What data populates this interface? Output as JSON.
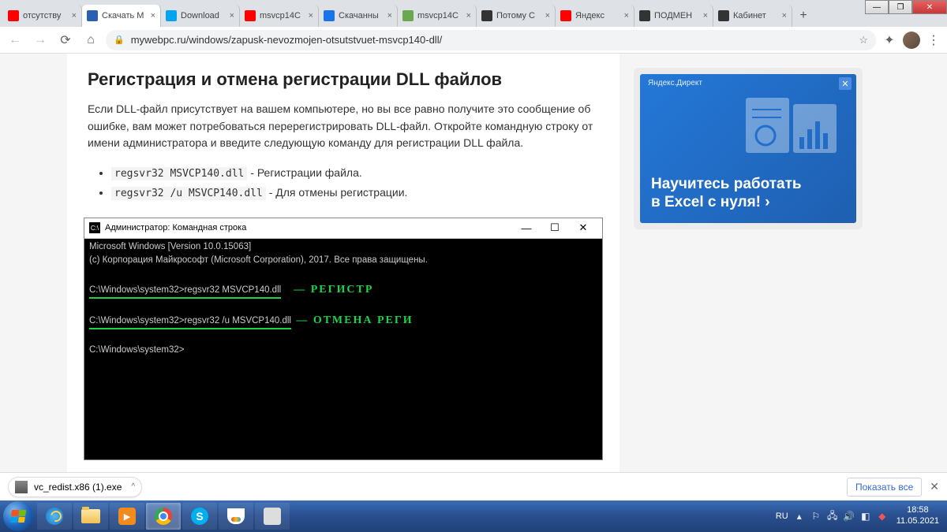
{
  "window_controls": {
    "min": "—",
    "max": "❐",
    "close": "✕"
  },
  "tabs": [
    {
      "title": "отсутству",
      "icon": "#ff0000"
    },
    {
      "title": "Скачать M",
      "icon": "#2b5fb0",
      "active": true
    },
    {
      "title": "Download",
      "icon": "#00a4ef"
    },
    {
      "title": "msvcp14C",
      "icon": "#ff0000"
    },
    {
      "title": "Скачанны",
      "icon": "#1a73e8"
    },
    {
      "title": "msvcp14C",
      "icon": "#6aa84f"
    },
    {
      "title": "Потому C",
      "icon": "#333"
    },
    {
      "title": "Яндекс",
      "icon": "#ff0000"
    },
    {
      "title": "ПОДМЕН",
      "icon": "#333"
    },
    {
      "title": "Кабинет",
      "icon": "#333"
    }
  ],
  "newtab": "+",
  "url": "mywebpc.ru/windows/zapusk-nevozmojen-otsutstvuet-msvcp140-dll/",
  "article": {
    "heading": "Регистрация и отмена регистрации DLL файлов",
    "para": "Если DLL-файл присутствует на вашем компьютере, но вы все равно получите это сообщение об ошибке, вам может потребоваться перерегистрировать DLL-файл. Откройте командную строку от имени администратора и введите следующую команду для регистрации DLL файла.",
    "li1_code": "regsvr32 MSVCP140.dll",
    "li1_text": " - Регистрации файла.",
    "li2_code": "regsvr32 /u MSVCP140.dll",
    "li2_text": " - Для отмены регистрации."
  },
  "cmd": {
    "title": "Администратор: Командная строка",
    "l1": "Microsoft Windows [Version 10.0.15063]",
    "l2": "(c) Корпорация Майкрософт (Microsoft Corporation), 2017. Все права защищены.",
    "l3": "C:\\Windows\\system32>regsvr32 MSVCP140.dll",
    "anno1": "— РЕГИСТР",
    "l4": "C:\\Windows\\system32>regsvr32 /u MSVCP140.dll",
    "anno2": "— ОТМЕНА РЕГИ",
    "l5": "C:\\Windows\\system32>",
    "min": "—",
    "max": "☐",
    "close": "✕"
  },
  "ad": {
    "label": "Яндекс.Директ",
    "text1": "Научитесь работать",
    "text2": "в Excel с нуля! ›"
  },
  "download": {
    "filename": "vc_redist.x86 (1).exe",
    "showall": "Показать все"
  },
  "tray": {
    "lang": "RU",
    "time": "18:58",
    "date": "11.05.2021"
  }
}
